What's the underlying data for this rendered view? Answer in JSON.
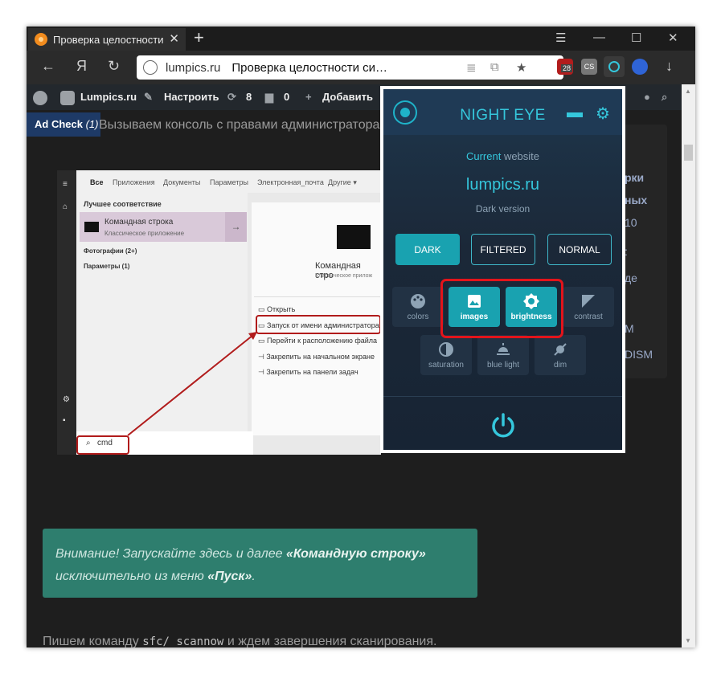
{
  "browser": {
    "tab_title": "Проверка целостности",
    "tab_close": "✕",
    "new_tab": "+",
    "window_controls": {
      "menu": "☰",
      "minimize": "—",
      "maximize": "☐",
      "close": "✕"
    },
    "nav": {
      "back": "←",
      "yandex": "Я",
      "reload": "↻",
      "download": "↓"
    },
    "address": {
      "host": "lumpics.ru",
      "page_title": "Проверка целостности си…",
      "bookmark": "★"
    },
    "extensions": {
      "ublock_badge": "28",
      "cs_label": "CS"
    }
  },
  "wp_bar": {
    "site": "Lumpics.ru",
    "customize": "Настроить",
    "updates_count": "8",
    "comments_count": "0",
    "add_new": "Добавить"
  },
  "content": {
    "ad_check": "Ad Check",
    "ad_check_count": "(1)",
    "lead_text": "Вызываем консоль с правами администратора",
    "right_column": [
      "рки",
      "ных",
      "10",
      ":",
      "де",
      "M",
      "DISM"
    ],
    "screenshot": {
      "tabs": [
        "Все",
        "Приложения",
        "Документы",
        "Параметры",
        "Электронная_почта",
        "Другие ▾"
      ],
      "best_match": "Лучшее соответствие",
      "app_name": "Командная строка",
      "app_type": "Классическое приложение",
      "photos": "Фотографии (2+)",
      "settings": "Параметры (1)",
      "right_title": "Командная стро",
      "right_sub": "Классическое прилож",
      "menu": [
        "Открыть",
        "Запуск от имени администратора",
        "Перейти к расположению файла",
        "Закрепить на начальном экране",
        "Закрепить на панели задач"
      ],
      "search_text": "cmd"
    },
    "alert": {
      "p1": "Внимание! Запускайте здесь и далее ",
      "b1": "«Командную строку»",
      "p2": "исключительно из меню ",
      "b2": "«Пуск»",
      "p3": "."
    },
    "para": {
      "before": "Пишем команду ",
      "code": "sfc/ scannow",
      "after": " и ждем завершения сканирования."
    }
  },
  "night_eye": {
    "brand": "NIGHT EYE",
    "current_label": "Current",
    "website_label": " website",
    "site": "lumpics.ru",
    "version": "Dark version",
    "modes": [
      {
        "label": "DARK",
        "active": true
      },
      {
        "label": "FILTERED",
        "active": false
      },
      {
        "label": "NORMAL",
        "active": false
      }
    ],
    "features": [
      {
        "label": "colors",
        "icon": "palette-icon",
        "on": false
      },
      {
        "label": "images",
        "icon": "image-icon",
        "on": true
      },
      {
        "label": "brightness",
        "icon": "brightness-icon",
        "on": true
      },
      {
        "label": "contrast",
        "icon": "contrast-icon",
        "on": false
      },
      {
        "label": "saturation",
        "icon": "saturation-icon",
        "on": false
      },
      {
        "label": "blue light",
        "icon": "blue-light-icon",
        "on": false
      },
      {
        "label": "dim",
        "icon": "dim-icon",
        "on": false
      }
    ],
    "accent": "#35c7dc",
    "active_bg": "#19a2b0"
  },
  "colors": {
    "highlight_red": "#e3141b",
    "annotation_red": "#b11b1b"
  }
}
